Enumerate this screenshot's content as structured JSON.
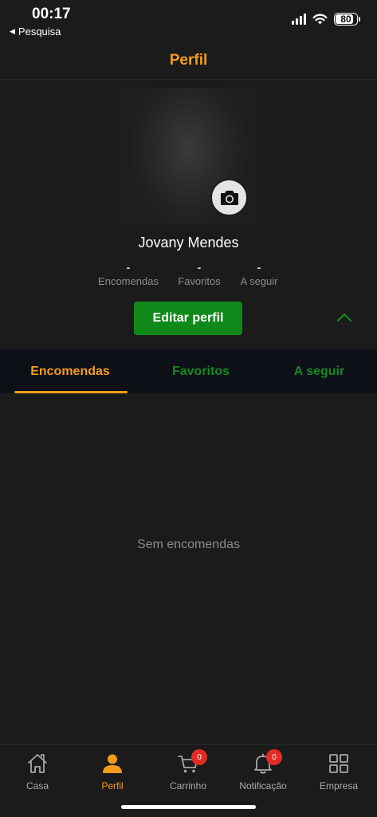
{
  "status_bar": {
    "time": "00:17",
    "back_label": "Pesquisa",
    "battery": "80",
    "battery_level": 0.8
  },
  "header": {
    "title": "Perfil"
  },
  "profile": {
    "name": "Jovany Mendes",
    "stats": [
      {
        "value": "-",
        "label": "Encomendas"
      },
      {
        "value": "-",
        "label": "Favoritos"
      },
      {
        "value": "-",
        "label": "A seguir"
      }
    ],
    "edit_label": "Editar perfil"
  },
  "tabs": [
    {
      "label": "Encomendas",
      "active": true
    },
    {
      "label": "Favoritos",
      "active": false
    },
    {
      "label": "A seguir",
      "active": false
    }
  ],
  "content": {
    "empty_message": "Sem encomendas"
  },
  "nav": [
    {
      "label": "Casa",
      "icon": "home-icon"
    },
    {
      "label": "Perfil",
      "icon": "user-icon",
      "active": true
    },
    {
      "label": "Carrinho",
      "icon": "cart-icon",
      "badge": "0"
    },
    {
      "label": "Notificação",
      "icon": "bell-icon",
      "badge": "0"
    },
    {
      "label": "Empresa",
      "icon": "grid-icon"
    }
  ],
  "colors": {
    "accent": "#f39c1c",
    "green": "#0f8a1a",
    "badge": "#e22b25",
    "background": "#1b1b1b"
  }
}
